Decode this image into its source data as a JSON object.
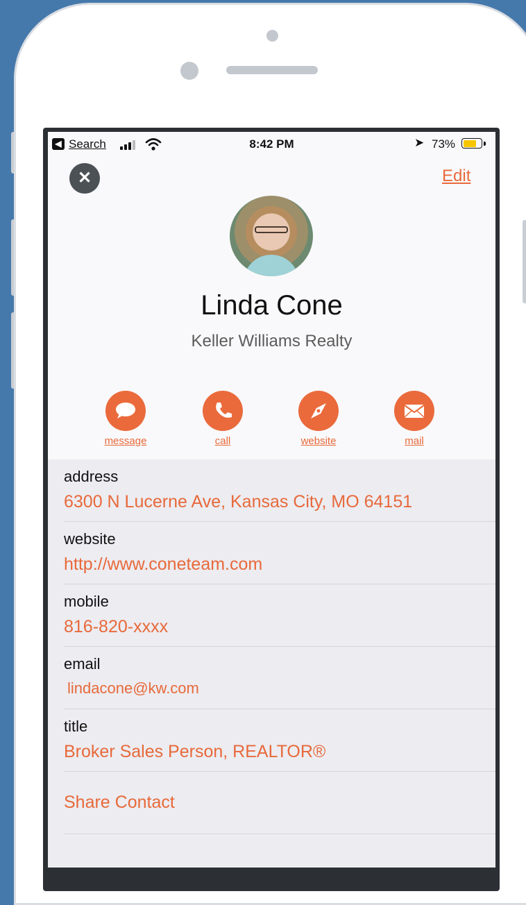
{
  "status_bar": {
    "back_label": "Search",
    "time": "8:42 PM",
    "battery": "73%",
    "battery_level": 0.73
  },
  "header": {
    "edit_label": "Edit"
  },
  "contact": {
    "name": "Linda Cone",
    "company": "Keller Williams Realty"
  },
  "actions": [
    {
      "label": "message",
      "icon": "message-bubble-icon"
    },
    {
      "label": "call",
      "icon": "phone-icon"
    },
    {
      "label": "website",
      "icon": "compass-icon"
    },
    {
      "label": "mail",
      "icon": "envelope-icon"
    }
  ],
  "fields": [
    {
      "key": "address",
      "value": "6300 N Lucerne Ave, Kansas City, MO 64151"
    },
    {
      "key": "website",
      "value": "http://www.coneteam.com"
    },
    {
      "key": "mobile",
      "value": "816-820-xxxx"
    },
    {
      "key": "email",
      "value": "lindacone@kw.com"
    },
    {
      "key": "title",
      "value": "Broker Sales Person, REALTOR®"
    }
  ],
  "share_label": "Share Contact",
  "colors": {
    "accent": "#e8693a",
    "background": "#4679ab"
  }
}
